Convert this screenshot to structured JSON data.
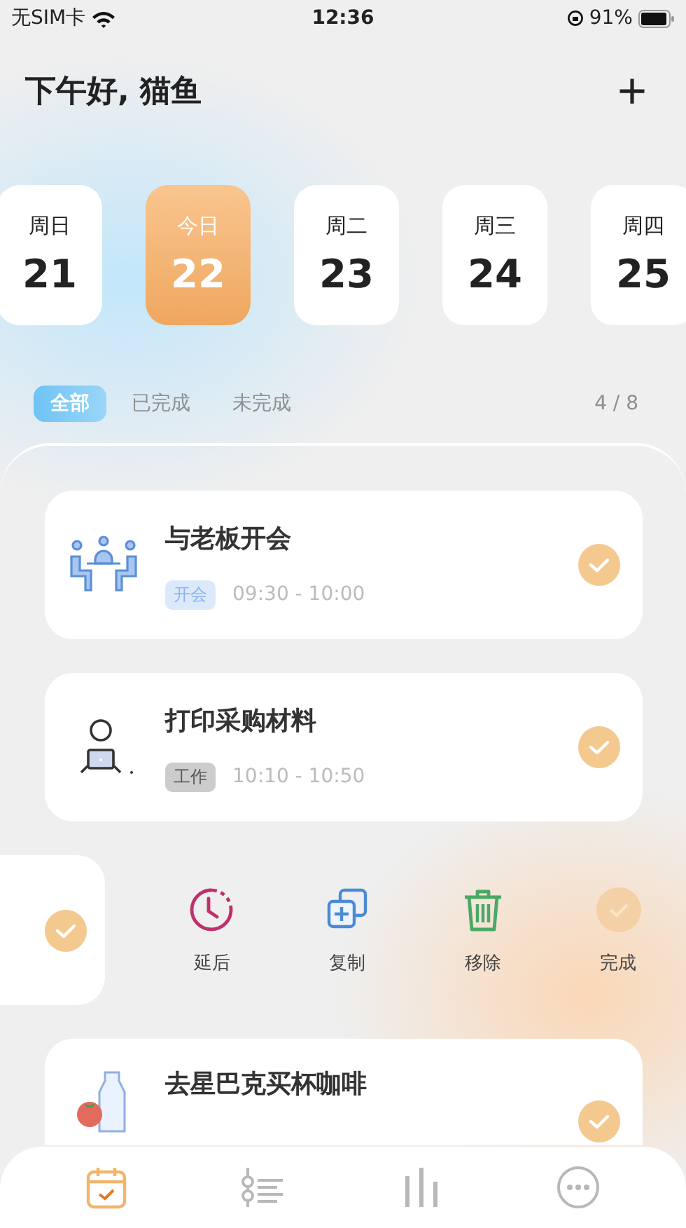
{
  "status_bar": {
    "carrier": "无SIM卡",
    "time": "12:36",
    "battery": "91%"
  },
  "header": {
    "greeting": "下午好, 猫鱼",
    "add_icon": "+"
  },
  "days": [
    {
      "weekday": "周日",
      "date": "21",
      "selected": false
    },
    {
      "weekday": "今日",
      "date": "22",
      "selected": true
    },
    {
      "weekday": "周二",
      "date": "23",
      "selected": false
    },
    {
      "weekday": "周三",
      "date": "24",
      "selected": false
    },
    {
      "weekday": "周四",
      "date": "25",
      "selected": false
    }
  ],
  "filters": [
    {
      "label": "全部",
      "selected": true
    },
    {
      "label": "已完成",
      "selected": false
    },
    {
      "label": "未完成",
      "selected": false
    }
  ],
  "count": "4 / 8",
  "tasks": [
    {
      "kind": "card",
      "title": "与老板开会",
      "tag": {
        "label": "开会",
        "color": "#8ab4f0"
      },
      "time": "09:30 - 10:00",
      "done": true
    },
    {
      "kind": "card",
      "title": "打印采购材料",
      "tag": {
        "label": "工作",
        "color": "#555555"
      },
      "time": "10:10 - 10:50",
      "done": true
    },
    {
      "kind": "swiped",
      "done": true,
      "actions": [
        {
          "label": "延后",
          "kind": "postpone"
        },
        {
          "label": "复制",
          "kind": "copy"
        },
        {
          "label": "移除",
          "kind": "remove"
        },
        {
          "label": "完成",
          "kind": "complete"
        }
      ]
    },
    {
      "kind": "card",
      "title": "去星巴克买杯咖啡",
      "done": true
    }
  ],
  "tabbar": [
    {
      "kind": "calendar",
      "selected": true
    },
    {
      "kind": "list",
      "selected": false
    },
    {
      "kind": "stats",
      "selected": false
    },
    {
      "kind": "more",
      "selected": false
    }
  ]
}
